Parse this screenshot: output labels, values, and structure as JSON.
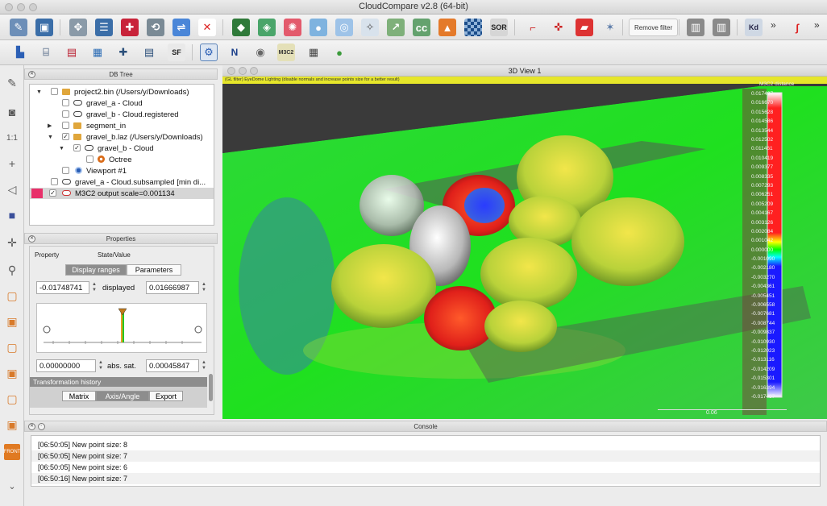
{
  "window": {
    "title": "CloudCompare v2.8 (64-bit)"
  },
  "toolbar_main": {
    "icons": [
      "open-icon",
      "save-icon",
      "point-picking-icon",
      "list-icon",
      "translate-icon",
      "rotate-icon",
      "sample-icon",
      "delete-icon",
      "merge-icon",
      "filter-icon",
      "noise-icon",
      "sphere-icon",
      "smooth-icon",
      "normals-icon",
      "cc-icon",
      "fire-icon",
      "checker-icon",
      "sor-icon",
      "dot-icon",
      "section-icon",
      "segment-icon",
      "star-icon",
      "histogram-icon",
      "histogram-icon-2",
      "kd-icon",
      "label-icon"
    ],
    "sor_label": "SOR",
    "remove_filter_label": "Remove filter",
    "kd_label": "Kd",
    "overflow_label": "»"
  },
  "toolbar_sf": {
    "sf_label": "SF",
    "n_label": "N",
    "m3c2_label": "M3C2"
  },
  "db_tree": {
    "title": "DB Tree",
    "items": [
      {
        "label": "project2.bin (/Users/y/Downloads)",
        "type": "folder",
        "checked": false
      },
      {
        "label": "gravel_a - Cloud",
        "type": "cloud",
        "checked": false
      },
      {
        "label": "gravel_b - Cloud.registered",
        "type": "cloud",
        "checked": false
      },
      {
        "label": "segment_in",
        "type": "folder",
        "checked": false
      },
      {
        "label": "gravel_b.laz (/Users/y/Downloads)",
        "type": "folder",
        "checked": true
      },
      {
        "label": "gravel_b - Cloud",
        "type": "cloud",
        "checked": true
      },
      {
        "label": "Octree",
        "type": "octree",
        "checked": false
      },
      {
        "label": "Viewport #1",
        "type": "viewport",
        "checked": false
      },
      {
        "label": "gravel_a - Cloud.subsampled [min di...",
        "type": "cloud",
        "checked": false
      },
      {
        "label": "M3C2 output scale=0.001134",
        "type": "cloud",
        "checked": true
      }
    ]
  },
  "properties": {
    "title": "Properties",
    "col_property": "Property",
    "col_state": "State/Value",
    "tab_display_ranges": "Display ranges",
    "tab_parameters": "Parameters",
    "display_min": "-0.01748741",
    "displayed_label": "displayed",
    "display_max": "0.01666987",
    "sat_min": "0.00000000",
    "abs_sat_label": "abs. sat.",
    "sat_max": "0.00045847",
    "transformation_history": "Transformation history",
    "btn_matrix": "Matrix",
    "btn_axis_angle": "Axis/Angle",
    "btn_export": "Export"
  },
  "view3d": {
    "title": "3D View 1",
    "message": "(GL filter) EyeDome Lighting (disable normals and increase points size for a better result)",
    "scale_value": "0.06"
  },
  "scalar_bar": {
    "title": "M3C2 distance",
    "labels": [
      "0.017497",
      "0.016670",
      "0.015628",
      "0.014586",
      "0.013544",
      "0.012502",
      "0.011461",
      "0.010419",
      "0.009377",
      "0.008335",
      "0.007293",
      "0.006251",
      "0.005209",
      "0.004167",
      "0.003126",
      "0.002084",
      "0.001042",
      "0.000000",
      "-0.001090",
      "-0.002180",
      "-0.003270",
      "-0.004361",
      "-0.005451",
      "-0.006558",
      "-0.007681",
      "-0.008744",
      "-0.009837",
      "-0.010930",
      "-0.012023",
      "-0.013116",
      "-0.014209",
      "-0.015301",
      "-0.016394",
      "-0.017487"
    ],
    "colors": {
      "top": "#ffffff",
      "positive": "#ff1a1a",
      "zero_high": "#ffff00",
      "zero": "#00ff00",
      "zero_low": "#00ffff",
      "negative": "#1a1aff",
      "bottom": "#ffffff"
    }
  },
  "console": {
    "title": "Console",
    "lines": [
      "[06:50:05] New point size: 8",
      "[06:50:05] New point size: 7",
      "[06:50:05] New point size: 6",
      "[06:50:16] New point size: 7"
    ]
  }
}
